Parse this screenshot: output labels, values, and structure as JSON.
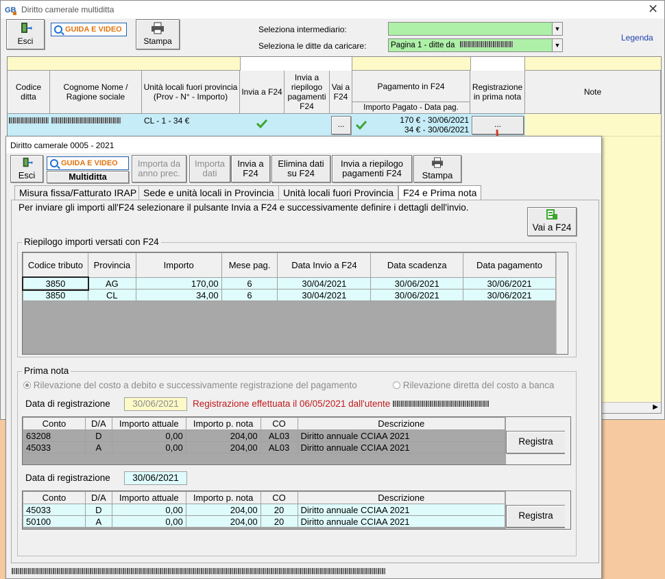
{
  "main": {
    "title": "Diritto camerale multiditta",
    "toolbar": {
      "esci": "Esci",
      "guida": "GUIDA E VIDEO",
      "stampa": "Stampa",
      "legenda": "Legenda"
    },
    "filters": {
      "intermediario_label": "Seleziona intermediario:",
      "intermediario_value": "",
      "ditte_label": "Seleziona le ditte da caricare:",
      "ditte_value": "Pagina 1 - ditte da"
    },
    "grid": {
      "headers": {
        "codice": "Codice ditta",
        "ragione": "Cognome Nome / Ragione sociale",
        "unita": "Unità locali fuori provincia (Prov - N° - Importo)",
        "invia": "Invia a F24",
        "riepilogo": "Invia a riepilogo pagamenti F24",
        "vai": "Vai a F24",
        "pagamento": "Pagamento in F24",
        "pagamento_sub": "Importo Pagato - Data pag.",
        "registrazione": "Registrazione in prima nota",
        "note": "Note"
      },
      "row": {
        "unita": "CL - 1 - 34 €",
        "vai_btn": "...",
        "pag_line1": "170 € - 30/06/2021",
        "pag_line2": "34 € - 30/06/2021",
        "reg_btn": "..."
      }
    }
  },
  "dialog": {
    "title": "Diritto camerale 0005 - 2021",
    "toolbar": {
      "esci": "Esci",
      "guida": "GUIDA E VIDEO",
      "multiditta": "Multiditta",
      "importa_prec": "Importa da anno prec.",
      "importa_dati": "Importa dati",
      "invia_f24": "Invia a F24",
      "elimina": "Elimina dati su F24",
      "invia_riepilogo": "Invia a riepilogo pagamenti F24",
      "stampa": "Stampa"
    },
    "tabs": [
      "Misura fissa/Fatturato IRAP",
      "Sede e unità locali in Provincia",
      "Unità locali fuori Provincia",
      "F24 e Prima nota"
    ],
    "info_text": "Per inviare gli importi all'F24 selezionare il pulsante Invia a F24 e successivamente definire i dettagli dell'invio.",
    "vai_f24": "Vai a F24",
    "riepilogo": {
      "title": "Riepilogo importi versati con F24",
      "columns": [
        "Codice tributo",
        "Provincia",
        "Importo",
        "Mese pag.",
        "Data Invio a F24",
        "Data scadenza",
        "Data pagamento"
      ],
      "rows": [
        [
          "3850",
          "AG",
          "170,00",
          "6",
          "30/04/2021",
          "30/06/2021",
          "30/06/2021"
        ],
        [
          "3850",
          "CL",
          "34,00",
          "6",
          "30/04/2021",
          "30/06/2021",
          "30/06/2021"
        ]
      ]
    },
    "prima_nota": {
      "title": "Prima nota",
      "radio1": "Rilevazione del costo a debito e successivamente registrazione del pagamento",
      "radio2": "Rilevazione diretta del costo a banca",
      "data_label": "Data di registrazione",
      "data1": "30/06/2021",
      "reg_msg": "Registrazione effettuata il 06/05/2021 dall'utente",
      "data2": "30/06/2021",
      "columns": [
        "Conto",
        "D/A",
        "Importo attuale",
        "Importo p. nota",
        "CO",
        "Descrizione"
      ],
      "rows1": [
        [
          "63208",
          "D",
          "0,00",
          "204,00",
          "AL03",
          "Diritto annuale CCIAA 2021"
        ],
        [
          "45033",
          "A",
          "0,00",
          "204,00",
          "AL03",
          "Diritto annuale CCIAA 2021"
        ]
      ],
      "rows2": [
        [
          "45033",
          "D",
          "0,00",
          "204,00",
          "20",
          "Diritto annuale CCIAA 2021"
        ],
        [
          "50100",
          "A",
          "0,00",
          "204,00",
          "20",
          "Diritto annuale CCIAA 2021"
        ]
      ],
      "registra": "Registra"
    }
  }
}
